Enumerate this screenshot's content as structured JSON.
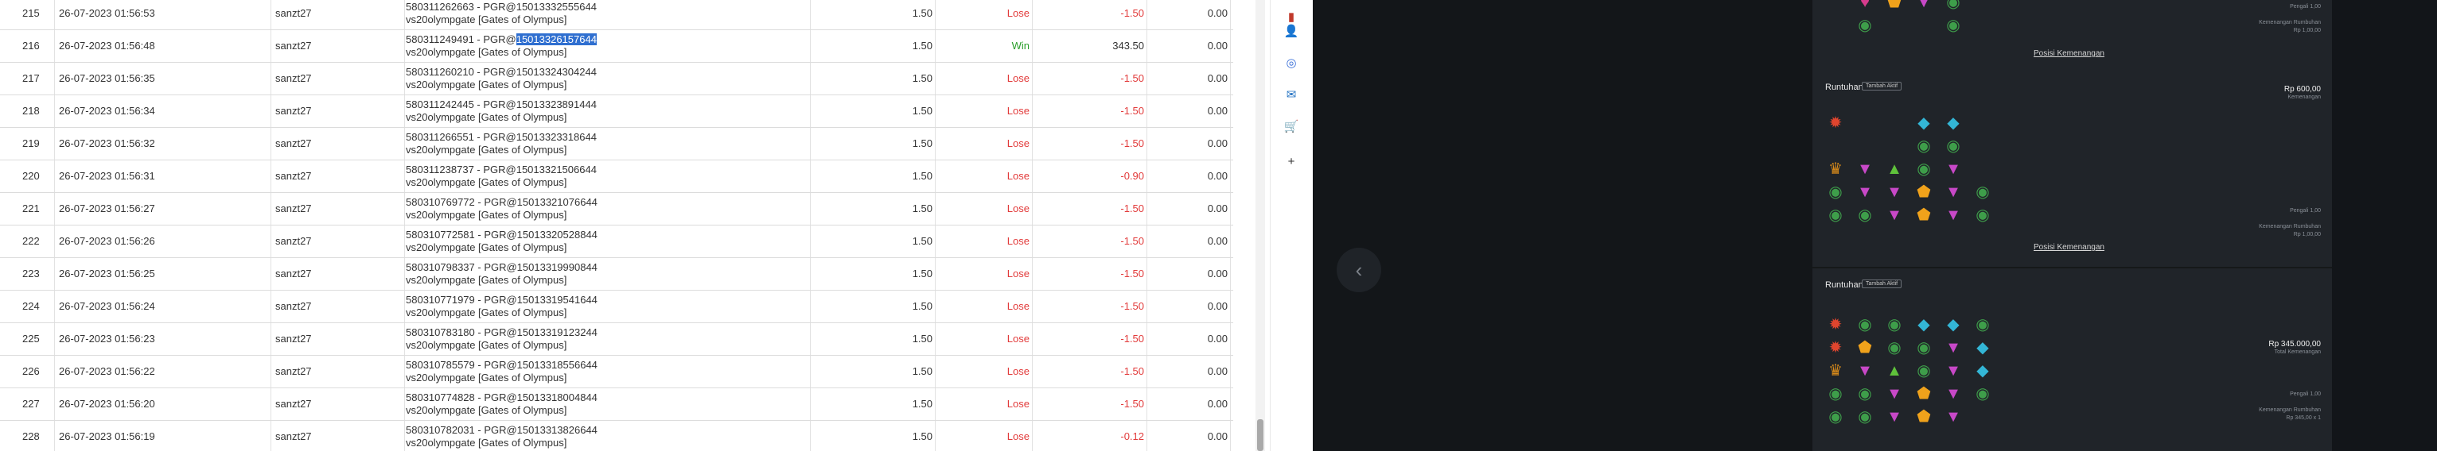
{
  "table": {
    "rows": [
      {
        "no": "215",
        "date": "26-07-2023 01:56:53",
        "user": "sanzt27",
        "id_pre": "580311262663 - PGR@15013332555644",
        "id_hl": "",
        "id_post": "",
        "game": "vs20olympgate [Gates of Olympus]",
        "bet": "1.50",
        "result": "Lose",
        "amount": "-1.50",
        "balance": "0.00"
      },
      {
        "no": "216",
        "date": "26-07-2023 01:56:48",
        "user": "sanzt27",
        "id_pre": "580311249491 - PGR@",
        "id_hl": "15013326157644",
        "id_post": "",
        "game": "vs20olympgate [Gates of Olympus]",
        "bet": "1.50",
        "result": "Win",
        "amount": "343.50",
        "balance": "0.00"
      },
      {
        "no": "217",
        "date": "26-07-2023 01:56:35",
        "user": "sanzt27",
        "id_pre": "580311260210 - PGR@15013324304244",
        "id_hl": "",
        "id_post": "",
        "game": "vs20olympgate [Gates of Olympus]",
        "bet": "1.50",
        "result": "Lose",
        "amount": "-1.50",
        "balance": "0.00"
      },
      {
        "no": "218",
        "date": "26-07-2023 01:56:34",
        "user": "sanzt27",
        "id_pre": "580311242445 - PGR@15013323891444",
        "id_hl": "",
        "id_post": "",
        "game": "vs20olympgate [Gates of Olympus]",
        "bet": "1.50",
        "result": "Lose",
        "amount": "-1.50",
        "balance": "0.00"
      },
      {
        "no": "219",
        "date": "26-07-2023 01:56:32",
        "user": "sanzt27",
        "id_pre": "580311266551 - PGR@15013323318644",
        "id_hl": "",
        "id_post": "",
        "game": "vs20olympgate [Gates of Olympus]",
        "bet": "1.50",
        "result": "Lose",
        "amount": "-1.50",
        "balance": "0.00"
      },
      {
        "no": "220",
        "date": "26-07-2023 01:56:31",
        "user": "sanzt27",
        "id_pre": "580311238737 - PGR@15013321506644",
        "id_hl": "",
        "id_post": "",
        "game": "vs20olympgate [Gates of Olympus]",
        "bet": "1.50",
        "result": "Lose",
        "amount": "-0.90",
        "balance": "0.00"
      },
      {
        "no": "221",
        "date": "26-07-2023 01:56:27",
        "user": "sanzt27",
        "id_pre": "580310769772 - PGR@15013321076644",
        "id_hl": "",
        "id_post": "",
        "game": "vs20olympgate [Gates of Olympus]",
        "bet": "1.50",
        "result": "Lose",
        "amount": "-1.50",
        "balance": "0.00"
      },
      {
        "no": "222",
        "date": "26-07-2023 01:56:26",
        "user": "sanzt27",
        "id_pre": "580310772581 - PGR@15013320528844",
        "id_hl": "",
        "id_post": "",
        "game": "vs20olympgate [Gates of Olympus]",
        "bet": "1.50",
        "result": "Lose",
        "amount": "-1.50",
        "balance": "0.00"
      },
      {
        "no": "223",
        "date": "26-07-2023 01:56:25",
        "user": "sanzt27",
        "id_pre": "580310798337 - PGR@15013319990844",
        "id_hl": "",
        "id_post": "",
        "game": "vs20olympgate [Gates of Olympus]",
        "bet": "1.50",
        "result": "Lose",
        "amount": "-1.50",
        "balance": "0.00"
      },
      {
        "no": "224",
        "date": "26-07-2023 01:56:24",
        "user": "sanzt27",
        "id_pre": "580310771979 - PGR@15013319541644",
        "id_hl": "",
        "id_post": "",
        "game": "vs20olympgate [Gates of Olympus]",
        "bet": "1.50",
        "result": "Lose",
        "amount": "-1.50",
        "balance": "0.00"
      },
      {
        "no": "225",
        "date": "26-07-2023 01:56:23",
        "user": "sanzt27",
        "id_pre": "580310783180 - PGR@15013319123244",
        "id_hl": "",
        "id_post": "",
        "game": "vs20olympgate [Gates of Olympus]",
        "bet": "1.50",
        "result": "Lose",
        "amount": "-1.50",
        "balance": "0.00"
      },
      {
        "no": "226",
        "date": "26-07-2023 01:56:22",
        "user": "sanzt27",
        "id_pre": "580310785579 - PGR@15013318556644",
        "id_hl": "",
        "id_post": "",
        "game": "vs20olympgate [Gates of Olympus]",
        "bet": "1.50",
        "result": "Lose",
        "amount": "-1.50",
        "balance": "0.00"
      },
      {
        "no": "227",
        "date": "26-07-2023 01:56:20",
        "user": "sanzt27",
        "id_pre": "580310774828 - PGR@15013318004844",
        "id_hl": "",
        "id_post": "",
        "game": "vs20olympgate [Gates of Olympus]",
        "bet": "1.50",
        "result": "Lose",
        "amount": "-1.50",
        "balance": "0.00"
      },
      {
        "no": "228",
        "date": "26-07-2023 01:56:19",
        "user": "sanzt27",
        "id_pre": "580310782031 - PGR@15013313826644",
        "id_hl": "",
        "id_post": "",
        "game": "vs20olympgate [Gates of Olympus]",
        "bet": "1.50",
        "result": "Lose",
        "amount": "-0.12",
        "balance": "0.00"
      }
    ]
  },
  "extensions": {
    "icons": [
      "notebook-extension-icon",
      "user-extension-icon",
      "chrome-extension-icon",
      "outlook-icon",
      "cart-icon",
      "add-icon"
    ],
    "add_glyph": "+"
  },
  "game_panel": {
    "back_glyph": "‹",
    "cards": [
      {
        "title": "",
        "badge": "",
        "amount": "",
        "amount_sub": "",
        "small1": "Pengali 1,00",
        "small2": "Kemenangan Rumbuhan",
        "small3": "Rp 1,00,00",
        "link": "Posisi Kemenangan",
        "grid": [
          [
            "",
            "♥",
            "⬟",
            "▼",
            "◉"
          ],
          [
            "",
            "◉",
            "",
            "",
            "◉"
          ]
        ]
      },
      {
        "title": "Runtuhan",
        "badge": "Tambah Aktif",
        "amount": "Rp 600,00",
        "amount_sub": "Kemenangan",
        "small1": "Pengali 1,00",
        "small2": "Kemenangan Rumbuhan",
        "small3": "Rp 1,00,00",
        "link": "Posisi Kemenangan",
        "grid": [
          [
            "✹",
            "",
            "",
            "◆",
            "◆",
            ""
          ],
          [
            "",
            "",
            "",
            "◉",
            "◉",
            ""
          ],
          [
            "♛",
            "▼",
            "▲",
            "◉",
            "▼",
            ""
          ],
          [
            "◉",
            "▼",
            "▼",
            "⬟",
            "▼",
            "◉"
          ],
          [
            "◉",
            "◉",
            "▼",
            "⬟",
            "▼",
            "◉"
          ]
        ]
      },
      {
        "title": "Runtuhan",
        "badge": "Tambah Aktif",
        "amount": "Rp 345.000,00",
        "amount_sub": "Total Kemenangan",
        "small1": "Pengali 1,00",
        "small2": "Kemenangan Rumbuhan",
        "small3": "Rp 345,00 x 1",
        "link": "",
        "grid": [
          [
            "✹",
            "◉",
            "◉",
            "◆",
            "◆",
            "◉"
          ],
          [
            "✹",
            "⬟",
            "◉",
            "◉",
            "▼",
            "◆"
          ],
          [
            "♛",
            "▼",
            "▲",
            "◉",
            "▼",
            "◆"
          ],
          [
            "◉",
            "◉",
            "▼",
            "⬟",
            "▼",
            "◉"
          ],
          [
            "◉",
            "◉",
            "▼",
            "⬟",
            "▼",
            ""
          ]
        ]
      }
    ]
  },
  "colors": {
    "lose": "#e23b3b",
    "win": "#2c9f2c",
    "highlight": "#2f6fd0",
    "panel_bg": "#16191d"
  }
}
